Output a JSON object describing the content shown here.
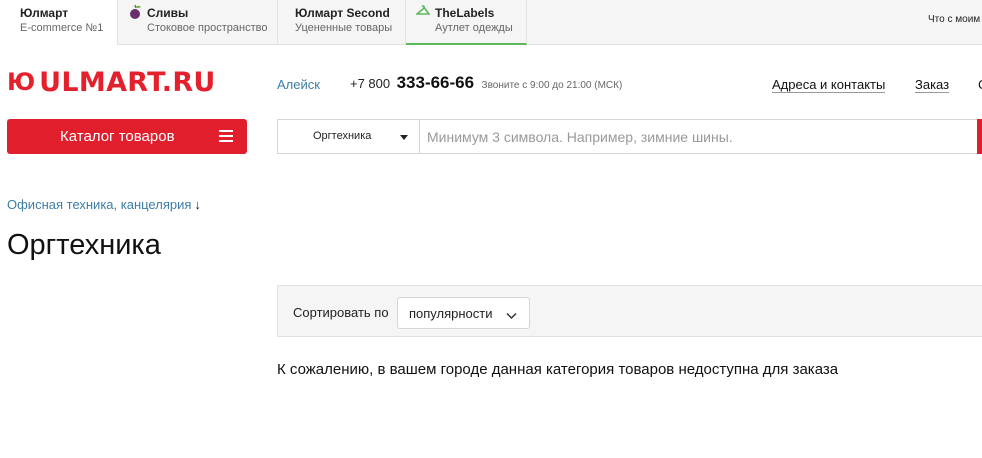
{
  "top_tabs": [
    {
      "name": "Юлмарт",
      "subtitle": "E-commerce №1"
    },
    {
      "name": "Сливы",
      "subtitle": "Стоковое пространство",
      "icon": "plum-icon"
    },
    {
      "name": "Юлмарт Second",
      "subtitle": "Уцененные товары"
    },
    {
      "name": "TheLabels",
      "subtitle": "Аутлет одежды",
      "icon": "hanger-icon"
    }
  ],
  "top_right_link": "Что с моим заказом?",
  "logo": {
    "mark": "Ю",
    "text": "ULMART.RU"
  },
  "header": {
    "city": "Алейск",
    "phone_prefix": "+7 800",
    "phone_number": "333-66-66",
    "phone_hours": "Звоните с 9:00 до 21:00 (МСК)",
    "links": [
      "Адреса и контакты",
      "Заказ",
      "С"
    ]
  },
  "catalog_button": {
    "label": "Каталог товаров"
  },
  "search": {
    "category": "Оргтехника",
    "placeholder": "Минимум 3 символа. Например, зимние шины."
  },
  "breadcrumb": {
    "label": "Офисная техника, канцелярия",
    "arrow": "↓"
  },
  "page_title": "Оргтехника",
  "sort": {
    "label": "Сортировать по",
    "value": "популярности"
  },
  "notice": "К сожалению, в вашем городе данная категория товаров недоступна для заказа",
  "colors": {
    "brand_red": "#e01e2c",
    "link_blue": "#3d7ea6",
    "tab_green": "#5cb85c",
    "plum": "#6b2d6b"
  }
}
